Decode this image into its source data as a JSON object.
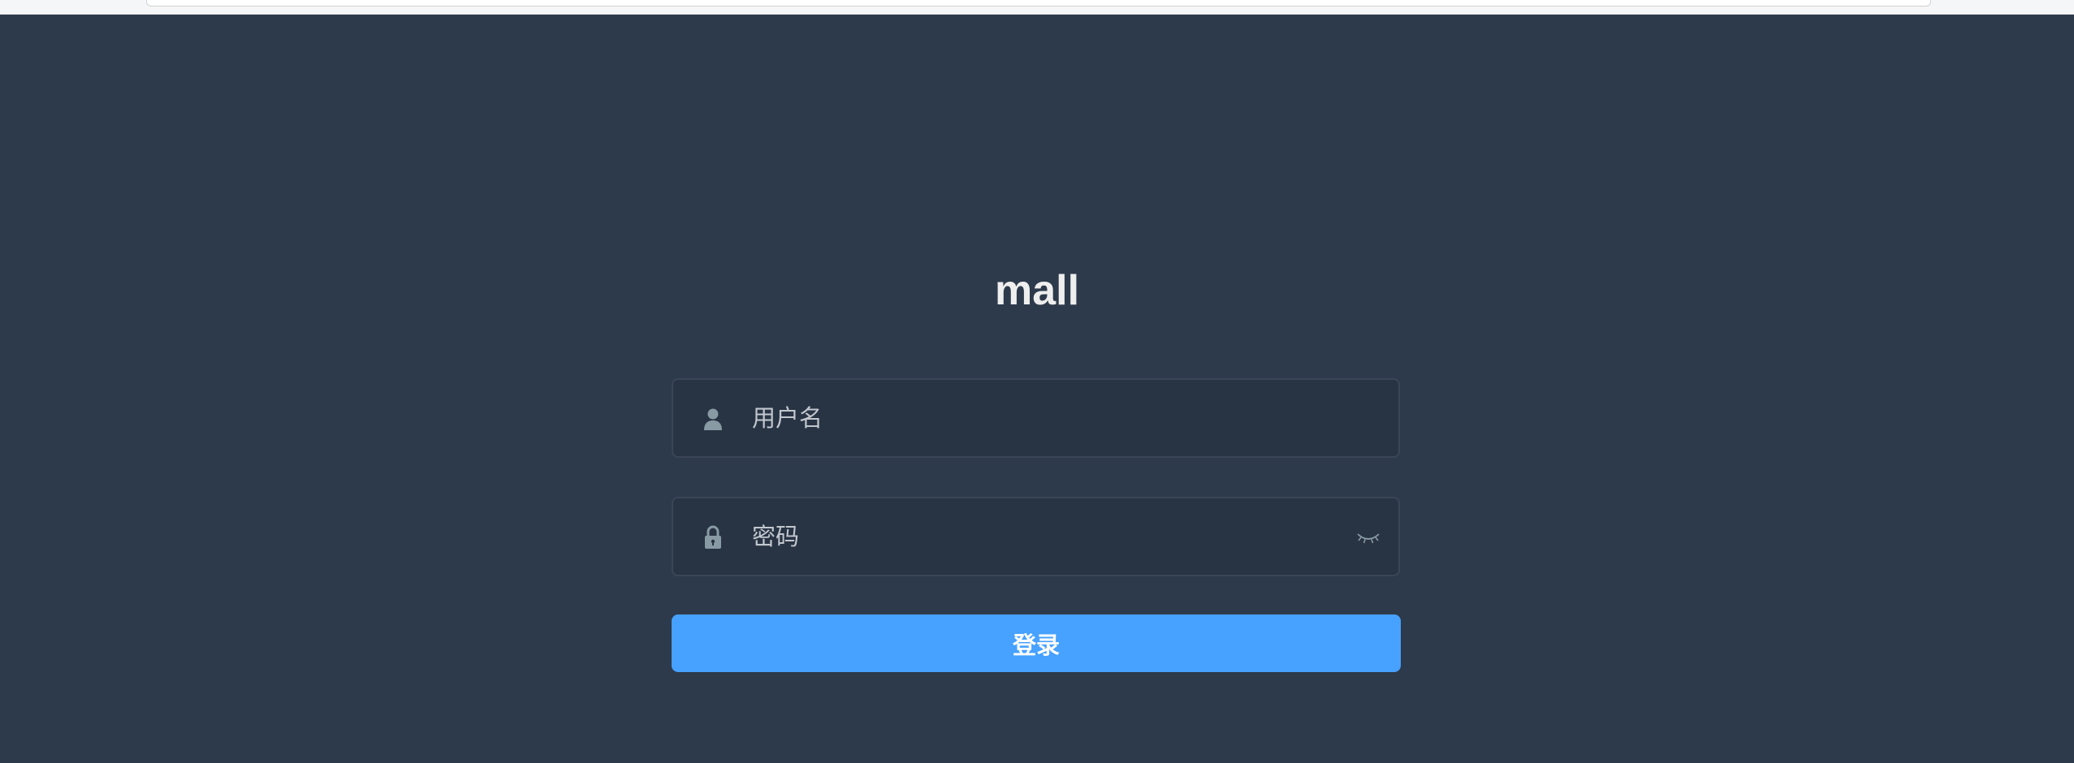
{
  "app": {
    "title": "mall"
  },
  "form": {
    "username": {
      "placeholder": "用户名",
      "value": "",
      "icon": "user-icon"
    },
    "password": {
      "placeholder": "密码",
      "value": "",
      "icon": "lock-icon",
      "toggle_icon": "eye-closed-icon"
    },
    "submit_label": "登录"
  },
  "colors": {
    "background": "#2d3a4b",
    "field_background": "#283443",
    "button": "#46a1ff",
    "title": "#eeeeee"
  }
}
